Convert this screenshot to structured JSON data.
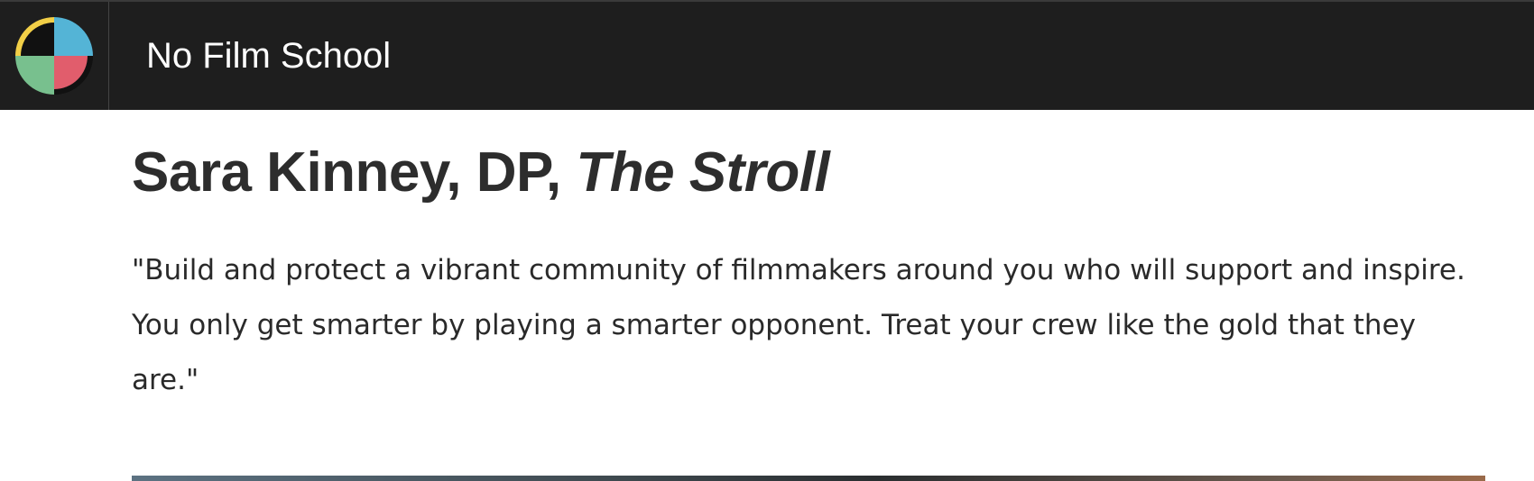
{
  "header": {
    "site_title": "No Film School",
    "logo_icon": "no-film-school-logo",
    "colors": {
      "background": "#1e1e1e",
      "logo_yellow": "#f2cf47",
      "logo_blue": "#54b4d6",
      "logo_green": "#78c08e",
      "logo_red": "#e15d6c"
    }
  },
  "article": {
    "heading_prefix": "Sara Kinney, DP, ",
    "heading_film": "The Stroll",
    "quote": "\"Build and protect a vibrant community of filmmakers around you who will support and inspire. You only get smarter by playing a smarter opponent. Treat your crew like the gold that they are.\""
  }
}
